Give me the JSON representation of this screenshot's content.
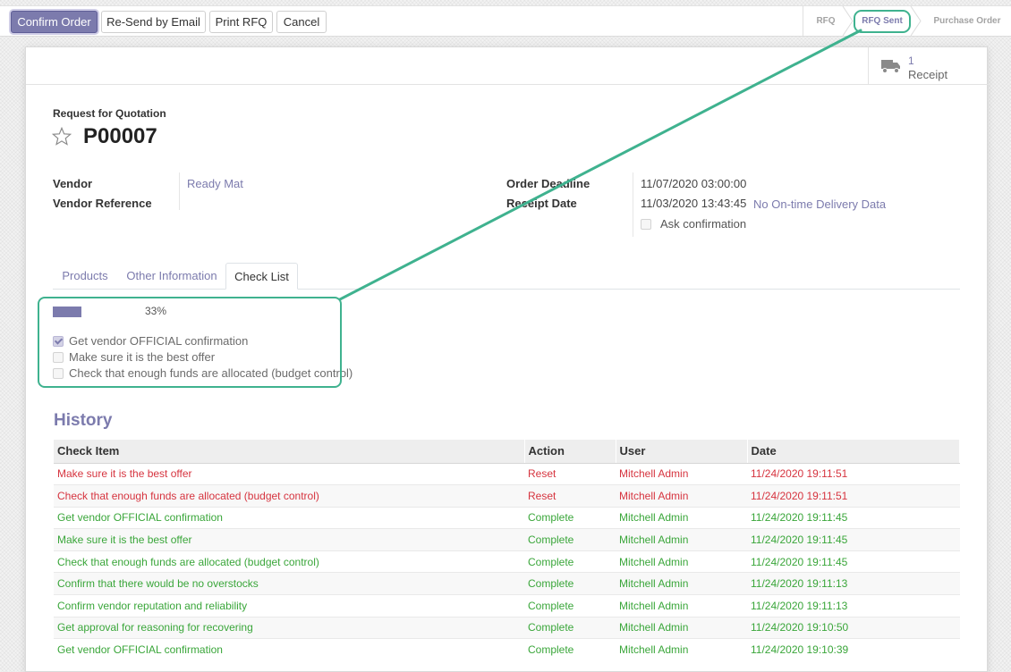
{
  "toolbar": {
    "confirm_label": "Confirm Order",
    "resend_label": "Re-Send by Email",
    "print_label": "Print RFQ",
    "cancel_label": "Cancel"
  },
  "statusbar": {
    "stages": [
      "RFQ",
      "RFQ Sent",
      "Purchase Order"
    ],
    "active": "RFQ Sent"
  },
  "smart_button": {
    "icon": "truck-icon",
    "value": "1",
    "label": "Receipt"
  },
  "header": {
    "subtitle": "Request for Quotation",
    "reference": "P00007",
    "favorite_icon": "star-outline-icon"
  },
  "fields": {
    "vendor_label": "Vendor",
    "vendor_value": "Ready Mat",
    "vendor_ref_label": "Vendor Reference",
    "deadline_label": "Order Deadline",
    "deadline_value": "11/07/2020 03:00:00",
    "receipt_label": "Receipt Date",
    "receipt_value": "11/03/2020 13:43:45",
    "delivery_link": "No On-time Delivery Data",
    "ask_confirmation": "Ask confirmation"
  },
  "tabs": [
    {
      "label": "Products"
    },
    {
      "label": "Other Information"
    },
    {
      "label": "Check List"
    }
  ],
  "active_tab": "Check List",
  "checklist": {
    "progress": 33,
    "progress_text": "33%",
    "items": [
      {
        "label": "Get vendor OFFICIAL confirmation",
        "checked": true
      },
      {
        "label": "Make sure it is the best offer",
        "checked": false
      },
      {
        "label": "Check that enough funds are allocated (budget control)",
        "checked": false
      }
    ]
  },
  "history": {
    "title": "History",
    "columns": [
      "Check Item",
      "Action",
      "User",
      "Date"
    ],
    "rows": [
      {
        "item": "Make sure it is the best offer",
        "action": "Reset",
        "user": "Mitchell Admin",
        "date": "11/24/2020 19:11:51"
      },
      {
        "item": "Check that enough funds are allocated (budget control)",
        "action": "Reset",
        "user": "Mitchell Admin",
        "date": "11/24/2020 19:11:51"
      },
      {
        "item": "Get vendor OFFICIAL confirmation",
        "action": "Complete",
        "user": "Mitchell Admin",
        "date": "11/24/2020 19:11:45"
      },
      {
        "item": "Make sure it is the best offer",
        "action": "Complete",
        "user": "Mitchell Admin",
        "date": "11/24/2020 19:11:45"
      },
      {
        "item": "Check that enough funds are allocated (budget control)",
        "action": "Complete",
        "user": "Mitchell Admin",
        "date": "11/24/2020 19:11:45"
      },
      {
        "item": "Confirm that there would be no overstocks",
        "action": "Complete",
        "user": "Mitchell Admin",
        "date": "11/24/2020 19:11:13"
      },
      {
        "item": "Confirm vendor reputation and reliability",
        "action": "Complete",
        "user": "Mitchell Admin",
        "date": "11/24/2020 19:11:13"
      },
      {
        "item": "Get approval for reasoning for recovering",
        "action": "Complete",
        "user": "Mitchell Admin",
        "date": "11/24/2020 19:10:50"
      },
      {
        "item": "Get vendor OFFICIAL confirmation",
        "action": "Complete",
        "user": "Mitchell Admin",
        "date": "11/24/2020 19:10:39"
      }
    ]
  },
  "colors": {
    "brand": "#7c7bad",
    "reset": "#d6343f",
    "complete": "#3aa63a",
    "annotation": "#3fb28f"
  }
}
